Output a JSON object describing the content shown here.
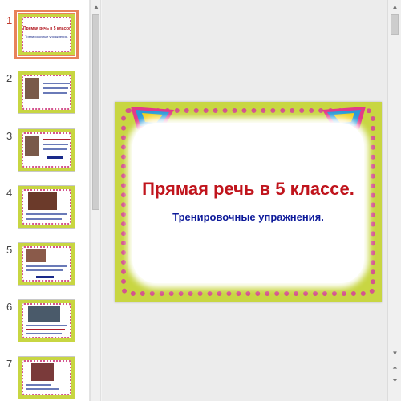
{
  "thumbnails": [
    {
      "number": "1",
      "selected": true,
      "title": "Прямая речь в 5 классе.",
      "subtitle": "Тренировочные упражнения."
    },
    {
      "number": "2",
      "selected": false
    },
    {
      "number": "3",
      "selected": false
    },
    {
      "number": "4",
      "selected": false
    },
    {
      "number": "5",
      "selected": false
    },
    {
      "number": "6",
      "selected": false
    },
    {
      "number": "7",
      "selected": false
    }
  ],
  "slide": {
    "title": "Прямая речь в 5 классе.",
    "subtitle": "Тренировочные упражнения."
  },
  "scrollbar": {
    "up_icon": "▲",
    "down_icon": "▼",
    "prev_slide_icon": "⏶",
    "next_slide_icon": "⏷"
  },
  "colors": {
    "slide_background": "#c8d642",
    "title_color": "#c0141c",
    "subtitle_color": "#0d1a9a",
    "selection_outline": "#e8825a"
  }
}
